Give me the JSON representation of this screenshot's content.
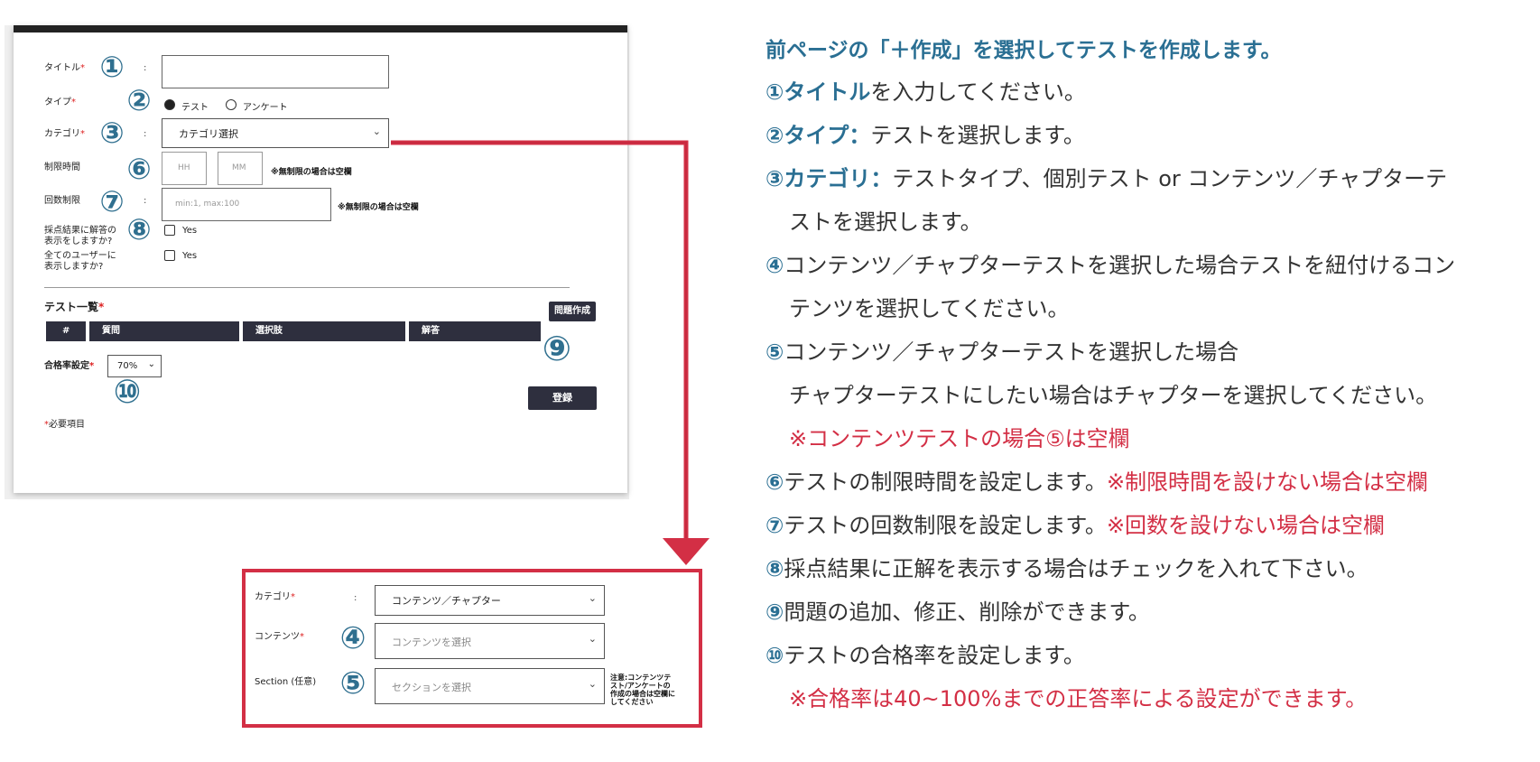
{
  "form": {
    "title_label": "タイトル",
    "type_label": "タイプ",
    "type_option_test": "テスト",
    "type_option_survey": "アンケート",
    "category_label": "カテゴリ",
    "category_select": "カテゴリ選択",
    "time_label": "制限時間",
    "time_hh_placeholder": "HH",
    "time_mm_placeholder": "MM",
    "time_note": "※無制限の場合は空欄",
    "attempts_label": "回数制限",
    "attempts_placeholder": "min:1, max:100",
    "attempts_note": "※無制限の場合は空欄",
    "show_answer_label_1": "採点結果に解答の",
    "show_answer_label_2": "表示をしますか?",
    "show_all_label_1": "全てのユーザーに",
    "show_all_label_2": "表示しますか?",
    "yes": "Yes",
    "test_list_label": "テスト一覧",
    "create_question_button": "問題作成",
    "table_headers": [
      "#",
      "質問",
      "選択肢",
      "解答"
    ],
    "pass_rate_label": "合格率設定",
    "pass_rate_value": "70%",
    "register_button": "登録",
    "required_note": "必要項目",
    "colon": ":",
    "required_mark": "*"
  },
  "badges": [
    "①",
    "②",
    "③",
    "④",
    "⑤",
    "⑥",
    "⑦",
    "⑧",
    "⑨",
    "⑩"
  ],
  "detail": {
    "category_label": "カテゴリ",
    "category_value": "コンテンツ／チャプター",
    "contents_label": "コンテンツ",
    "contents_placeholder": "コンテンツを選択",
    "section_label": "Section (任意)",
    "section_placeholder": "セクションを選択",
    "note": [
      "注意:コンテンツテ",
      "スト/アンケートの",
      "作成の場合は空欄に",
      "してください"
    ]
  },
  "instructions": {
    "heading": "前ページの「＋作成」を選択してテストを作成します。",
    "l1_num": "①",
    "l1_bold": "タイトル",
    "l1_rest": "を入力してください。",
    "l2_num": "②",
    "l2_bold": "タイプ：",
    "l2_rest": "テストを選択します。",
    "l3_num": "③",
    "l3_bold": "カテゴリ：",
    "l3_rest": "テストタイプ、個別テスト or コンテンツ／チャプターテ",
    "l3_cont": "ストを選択します。",
    "l4_num": "④",
    "l4_text": "コンテンツ／チャプターテストを選択した場合テストを紐付けるコン",
    "l4_cont": "テンツを選択してください。",
    "l5_num": "⑤",
    "l5_text": "コンテンツ／チャプターテストを選択した場合",
    "l5_cont": "チャプターテストにしたい場合はチャプターを選択してください。",
    "l5_note": "※コンテンツテストの場合⑤は空欄",
    "l6_num": "⑥",
    "l6_text": "テストの制限時間を設定します。",
    "l6_note": "※制限時間を設けない場合は空欄",
    "l7_num": "⑦",
    "l7_text": "テストの回数制限を設定します。",
    "l7_note": "※回数を設けない場合は空欄",
    "l8_num": "⑧",
    "l8_text": "採点結果に正解を表示する場合はチェックを入れて下さい。",
    "l9_num": "⑨",
    "l9_text": "問題の追加、修正、削除ができます。",
    "l10_num": "⑩",
    "l10_text": "テストの合格率を設定します。",
    "l10_note": "※合格率は40~100%までの正答率による設定ができます。"
  },
  "colors": {
    "accent_blue": "#2a6f93",
    "accent_red": "#d32f45",
    "dark": "#2e2f3e"
  }
}
